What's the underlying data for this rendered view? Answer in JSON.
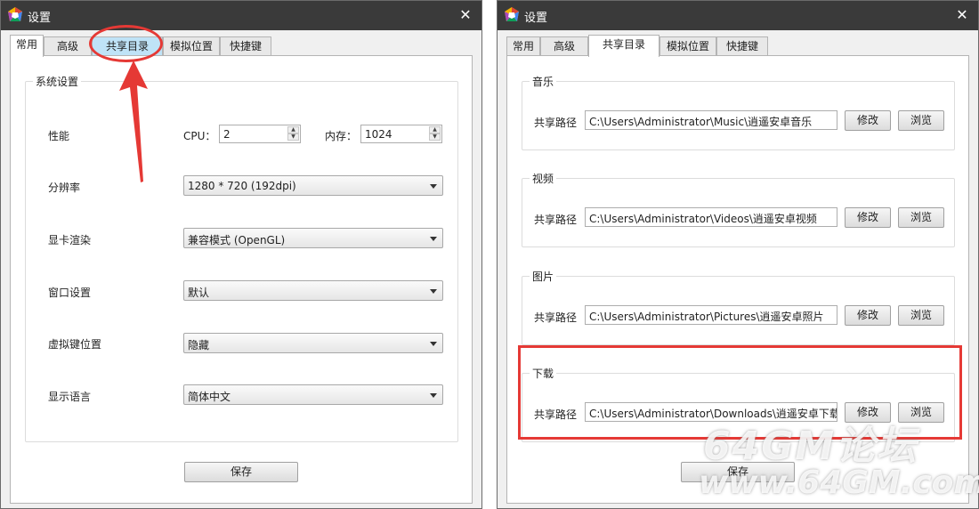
{
  "window": {
    "title": "设置",
    "close_glyph": "✕"
  },
  "tabs": [
    "常用",
    "高级",
    "共享目录",
    "模拟位置",
    "快捷键"
  ],
  "general": {
    "group_title": "系统设置",
    "performance": {
      "label": "性能",
      "cpu_label": "CPU：",
      "cpu_value": "2",
      "mem_label": "内存：",
      "mem_value": "1024"
    },
    "resolution": {
      "label": "分辨率",
      "value": "1280 * 720 (192dpi)"
    },
    "gpu_render": {
      "label": "显卡渲染",
      "value": "兼容模式 (OpenGL)"
    },
    "window_setting": {
      "label": "窗口设置",
      "value": "默认"
    },
    "virtual_keys": {
      "label": "虚拟键位置",
      "value": "隐藏"
    },
    "language": {
      "label": "显示语言",
      "value": "简体中文"
    },
    "save_label": "保存"
  },
  "shared": {
    "path_label": "共享路径",
    "modify_label": "修改",
    "browse_label": "浏览",
    "save_label": "保存",
    "groups": [
      {
        "title": "音乐",
        "path": "C:\\Users\\Administrator\\Music\\逍遥安卓音乐"
      },
      {
        "title": "视频",
        "path": "C:\\Users\\Administrator\\Videos\\逍遥安卓视频"
      },
      {
        "title": "图片",
        "path": "C:\\Users\\Administrator\\Pictures\\逍遥安卓照片"
      },
      {
        "title": "下载",
        "path": "C:\\Users\\Administrator\\Downloads\\逍遥安卓下载"
      }
    ]
  },
  "watermark": {
    "line1": "64GM论坛",
    "line2": "www.64GM.com"
  },
  "colors": {
    "titlebar": "#3a3a3a",
    "annotation": "#e53935",
    "active_tab_highlight": "#bfe3f7"
  }
}
